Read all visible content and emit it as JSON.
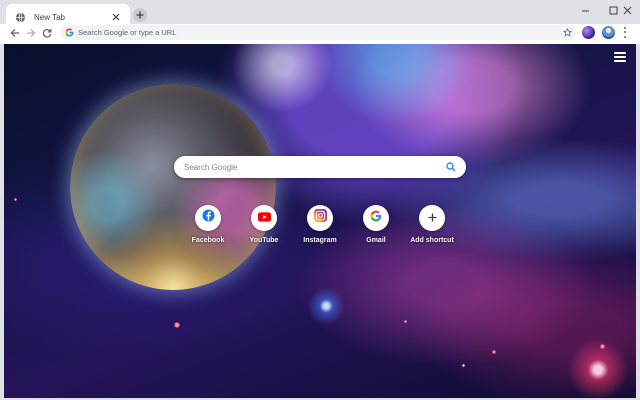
{
  "browser": {
    "tab": {
      "title": "New Tab"
    },
    "omnibox": {
      "placeholder": "Search Google or type a URL"
    }
  },
  "ntp": {
    "search": {
      "placeholder": "Search Google"
    },
    "shortcuts": [
      {
        "label": "Facebook",
        "icon": "facebook-icon",
        "color": "#1877f2"
      },
      {
        "label": "YouTube",
        "icon": "youtube-icon",
        "color": "#ff0000"
      },
      {
        "label": "Instagram",
        "icon": "instagram-icon",
        "color": "#d62976"
      },
      {
        "label": "Gmail",
        "icon": "google-icon",
        "color": "#4285f4"
      },
      {
        "label": "Add shortcut",
        "icon": "plus-icon",
        "color": "#3c4043"
      }
    ]
  },
  "colors": {
    "tabstrip": "#dee1e6",
    "toolbar": "#ffffff",
    "omnibox": "#f1f3f4",
    "text_muted": "#5f6368"
  }
}
